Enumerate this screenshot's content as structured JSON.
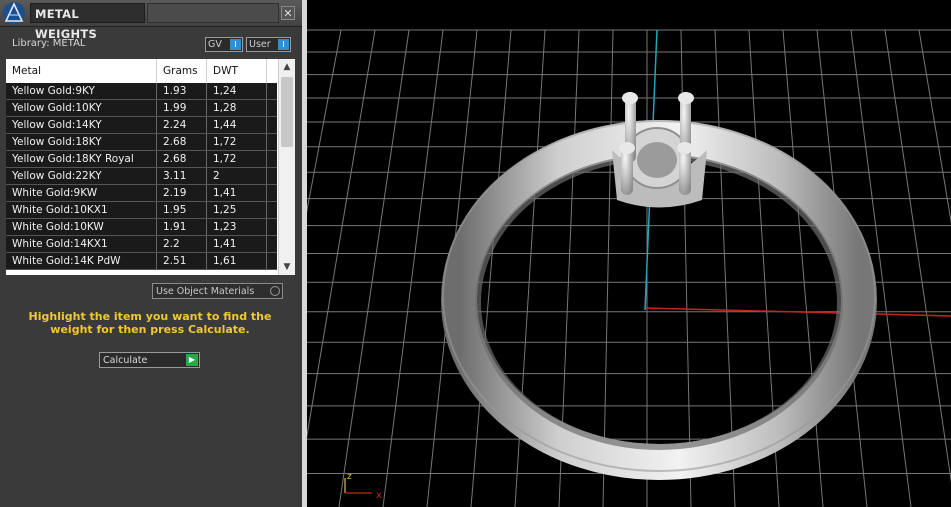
{
  "panel": {
    "title": "METAL WEIGHTS",
    "close_glyph": "✕",
    "library_label": "Library: METAL",
    "toggle_gv": "GV",
    "toggle_user": "User",
    "columns": [
      "Metal",
      "Grams",
      "DWT"
    ],
    "rows": [
      {
        "metal": "Yellow Gold:9KY",
        "grams": "1.93",
        "dwt": "1,24"
      },
      {
        "metal": "Yellow Gold:10KY",
        "grams": "1.99",
        "dwt": "1,28"
      },
      {
        "metal": "Yellow Gold:14KY",
        "grams": "2.24",
        "dwt": "1,44"
      },
      {
        "metal": "Yellow Gold:18KY",
        "grams": "2.68",
        "dwt": "1,72"
      },
      {
        "metal": "Yellow Gold:18KY Royal",
        "grams": "2.68",
        "dwt": "1,72"
      },
      {
        "metal": "Yellow Gold:22KY",
        "grams": "3.11",
        "dwt": "2"
      },
      {
        "metal": "White Gold:9KW",
        "grams": "2.19",
        "dwt": "1,41"
      },
      {
        "metal": "White Gold:10KX1",
        "grams": "1.95",
        "dwt": "1,25"
      },
      {
        "metal": "White Gold:10KW",
        "grams": "1.91",
        "dwt": "1,23"
      },
      {
        "metal": "White Gold:14KX1",
        "grams": "2.2",
        "dwt": "1,41"
      },
      {
        "metal": "White Gold:14K PdW",
        "grams": "2.51",
        "dwt": "1,61"
      }
    ],
    "use_object_materials": "Use Object Materials",
    "hint": "Highlight the item you want to find the weight for then press Calculate.",
    "calculate_label": "Calculate"
  },
  "viewport": {
    "axis_x_label": "x",
    "axis_z_label": "z"
  },
  "colors": {
    "hint": "#f2c832",
    "toggle_knob": "#2e8fd1",
    "calc_go": "#2aa84a",
    "axis_red": "#c0281e",
    "axis_cyan": "#1fa7b8"
  }
}
